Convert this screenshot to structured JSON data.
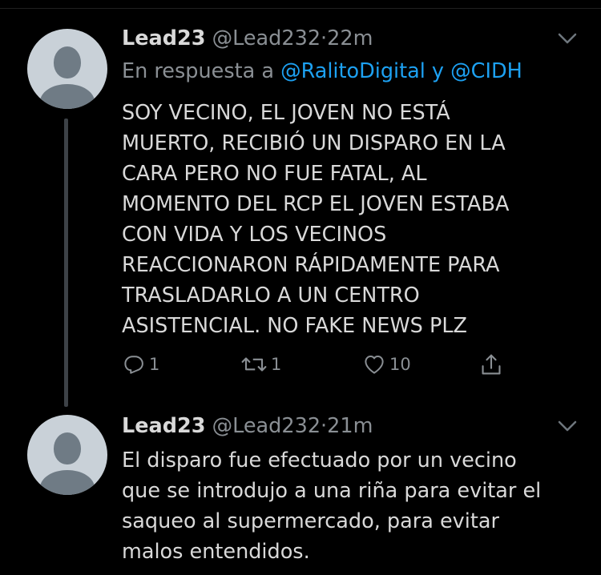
{
  "tweets": [
    {
      "name": "Lead23",
      "handle": "@Lead232",
      "dot": "·",
      "time": "22m",
      "reply_prefix": "En respuesta a ",
      "mention1": "@RalitoDigital",
      "reply_join": " y ",
      "mention2": "@CIDH",
      "text_lines": [
        "SOY VECINO, EL JOVEN NO ESTÁ",
        "MUERTO, RECIBIÓ UN DISPARO EN LA",
        "CARA PERO NO FUE FATAL, AL",
        "MOMENTO DEL RCP EL JOVEN ESTABA",
        "CON VIDA Y LOS VECINOS",
        "REACCIONARON RÁPIDAMENTE PARA",
        "TRASLADARLO A UN CENTRO",
        "ASISTENCIAL. NO FAKE NEWS PLZ"
      ],
      "replies": "1",
      "retweets": "1",
      "likes": "10"
    },
    {
      "name": "Lead23",
      "handle": "@Lead232",
      "dot": "·",
      "time": "21m",
      "text_lines": [
        "El disparo fue efectuado por un vecino",
        "que se introdujo a una riña para evitar el",
        "saqueo al supermercado, para evitar",
        "malos entendidos."
      ]
    }
  ],
  "icons": {
    "reply": "reply-icon",
    "retweet": "retweet-icon",
    "like": "heart-icon",
    "share": "share-icon",
    "menu": "chevron-down-icon"
  },
  "colors": {
    "background": "#000000",
    "text": "#d9d9d9",
    "muted": "#8a8f94",
    "link": "#1da1f2"
  }
}
